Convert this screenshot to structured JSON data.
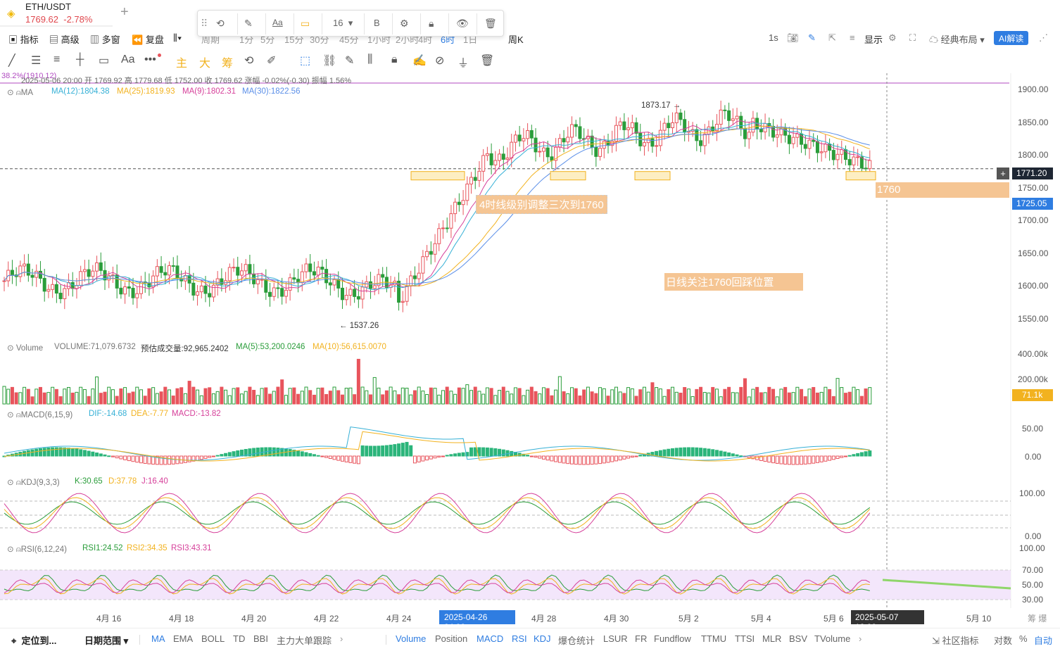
{
  "tab": {
    "symbol": "ETH/USDT",
    "price": "1769.62",
    "change": "-2.78%"
  },
  "row2": {
    "indicators": "指标",
    "advanced": "高级",
    "multi": "多窗",
    "replay": "复盘",
    "periods": [
      "周期",
      "1分",
      "5分",
      "15分",
      "30分",
      "45分",
      "1小时",
      "2小时",
      "4时",
      "6时",
      "1日",
      "周K"
    ],
    "interval": "1s",
    "display": "显示",
    "layout": "经典布局",
    "ai": "AI解读"
  },
  "toolbar": {
    "text_tool": "Aa",
    "main": "主",
    "big": "大",
    "chip": "筹"
  },
  "floatbar": {
    "font_size": "16",
    "bold": "B",
    "text": "Aa"
  },
  "ohlc": {
    "top_left": "38.2%(1910.12)",
    "text": "2025-05-06 20:00 开 1769.92 高 1779.68 低 1752.00 收 1769.62 涨幅 -0.02%(-0.30) 振幅 1.56%"
  },
  "ma_legend": {
    "name": "MA",
    "ma12": "MA(12):1804.38",
    "ma25": "MA(25):1819.93",
    "ma9": "MA(9):1802.31",
    "ma30": "MA(30):1822.56"
  },
  "price_axis": [
    "1900.00",
    "1850.00",
    "1800.00",
    "1771.20",
    "1750.00",
    "1725.05",
    "1700.00",
    "1650.00",
    "1600.00",
    "1550.00"
  ],
  "annotations": {
    "high": "1873.17",
    "low": "1537.26",
    "note1": "4时线级别调整三次到1760",
    "note2": "日线关注1760回踩位置",
    "level": "1760"
  },
  "volume": {
    "title": "Volume",
    "vol": "VOLUME:71,079.6732",
    "est": "预估成交量:92,965.2402",
    "ma5": "MA(5):53,200.0246",
    "ma10": "MA(10):56,615.0070",
    "axis": [
      "400.00k",
      "200.00k",
      "71.1k"
    ]
  },
  "macd": {
    "title": "MACD(6,15,9)",
    "dif": "DIF:-14.68",
    "dea": "DEA:-7.77",
    "macd": "MACD:-13.82",
    "axis": [
      "50.00",
      "0.00"
    ]
  },
  "kdj": {
    "title": "KDJ(9,3,3)",
    "k": "K:30.65",
    "d": "D:37.78",
    "j": "J:16.40",
    "axis": [
      "100.00",
      "0.00"
    ]
  },
  "rsi": {
    "title": "RSI(6,12,24)",
    "r1": "RSI1:24.52",
    "r2": "RSI2:34.35",
    "r3": "RSI3:43.31",
    "axis": [
      "100.00",
      "70.00",
      "50.00",
      "30.00"
    ]
  },
  "time_axis": [
    "4月 16",
    "4月 18",
    "4月 20",
    "4月 22",
    "4月 24",
    "2025-04-26 04:00",
    "4月 28",
    "4月 30",
    "5月 2",
    "5月 4",
    "5月 6",
    "2025-05-07 12:00",
    "5月 10"
  ],
  "time_axis_right": "筹 爆",
  "bottom": {
    "goto": "定位到...",
    "range": "日期范围",
    "main_indicators": [
      "MA",
      "EMA",
      "BOLL",
      "TD",
      "BBI",
      "主力大单跟踪"
    ],
    "sub_indicators": [
      "Volume",
      "Position",
      "MACD",
      "RSI",
      "KDJ",
      "爆仓统计",
      "LSUR",
      "FR",
      "Fundflow",
      "TTMU",
      "TTSI",
      "MLR",
      "BSV",
      "TVolume"
    ],
    "community": "社区指标",
    "log": "对数",
    "pct": "%",
    "auto": "自动"
  },
  "colors": {
    "up": "#e8545c",
    "down": "#2a9d3a",
    "ma12": "#36b0d6",
    "ma25": "#f2b21f",
    "ma9": "#d6409a",
    "ma30": "#5b8fe8",
    "accent": "#2f7de1",
    "orange": "#f5a65b"
  }
}
